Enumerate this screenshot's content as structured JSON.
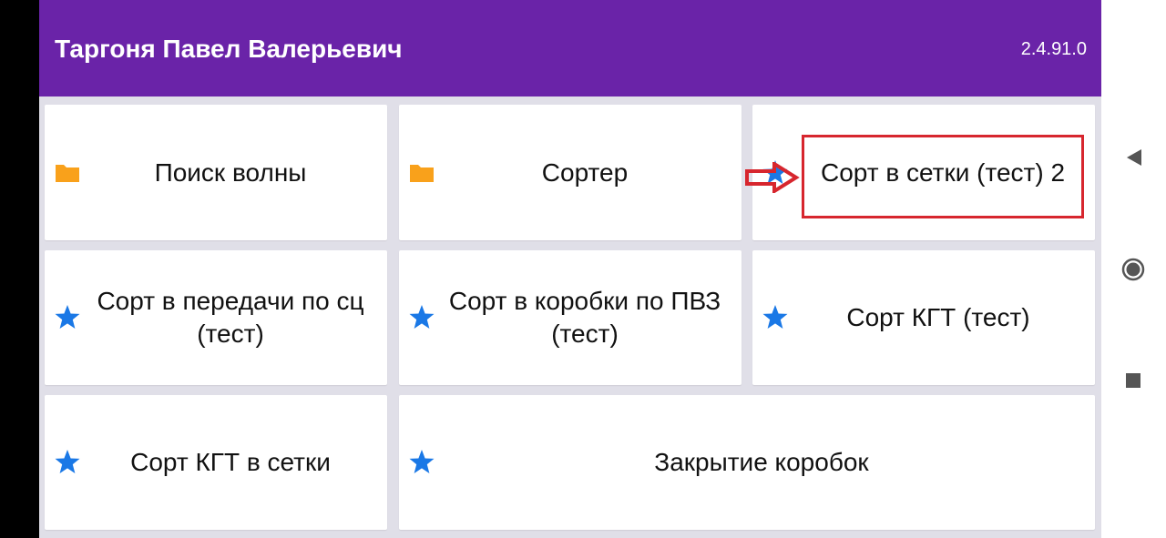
{
  "header": {
    "title": "Таргоня Павел Валерьевич",
    "version": "2.4.91.0"
  },
  "colors": {
    "header_bg": "#6a23a8",
    "grid_bg": "#e0dfe8",
    "folder_icon": "#f9a11b",
    "star_icon": "#1a78e6",
    "highlight": "#d7262e"
  },
  "tiles": [
    {
      "label": "Поиск волны",
      "icon": "folder-icon"
    },
    {
      "label": "Сортер",
      "icon": "folder-icon"
    },
    {
      "label": "Сорт в сетки (тест) 2",
      "icon": "star-icon"
    },
    {
      "label": "Сорт в передачи по сц (тест)",
      "icon": "star-icon"
    },
    {
      "label": "Сорт в коробки по ПВЗ (тест)",
      "icon": "star-icon"
    },
    {
      "label": "Сорт КГТ (тест)",
      "icon": "star-icon"
    },
    {
      "label": "Сорт КГТ в сетки",
      "icon": "star-icon"
    },
    {
      "label": "Закрытие коробок",
      "icon": "star-icon"
    }
  ],
  "nav": {
    "back": "back-triangle-icon",
    "home": "home-circle-icon",
    "recents": "recents-square-icon"
  }
}
